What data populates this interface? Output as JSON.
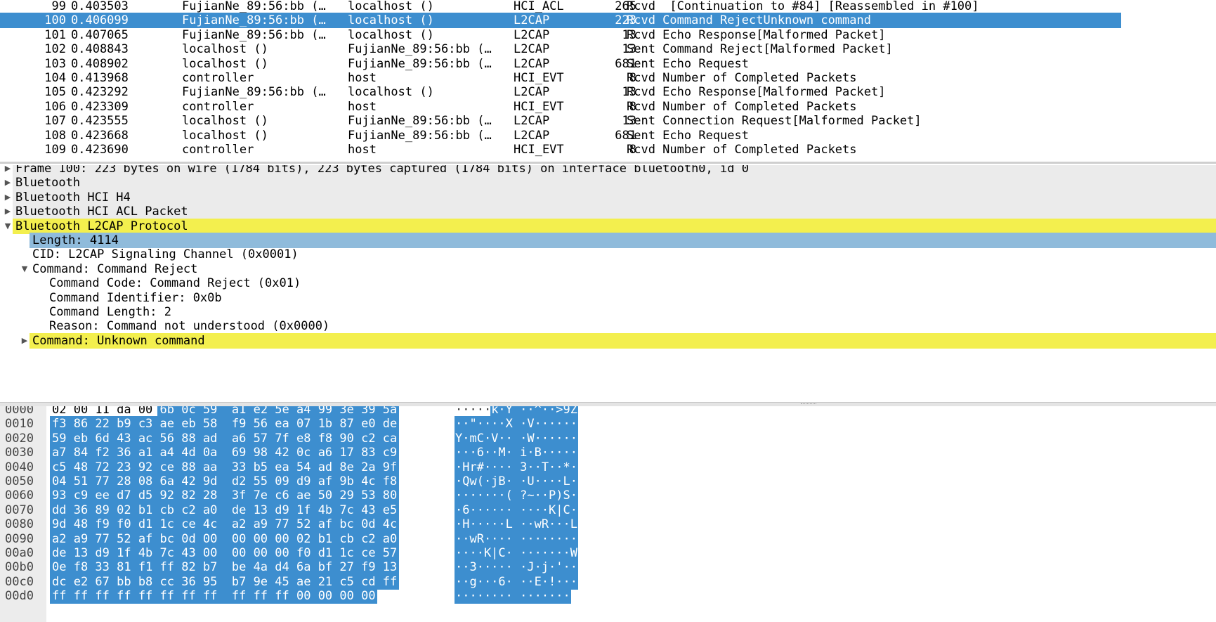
{
  "packet_list": {
    "rows": [
      {
        "no": "99",
        "time": "0.403503",
        "src": "FujianNe_89:56:bb (…",
        "dst": "localhost ()",
        "proto": "HCI_ACL",
        "len": "265",
        "info": "Rcvd  [Continuation to #84] [Reassembled in #100]",
        "selected": false
      },
      {
        "no": "100",
        "time": "0.406099",
        "src": "FujianNe_89:56:bb (…",
        "dst": "localhost ()",
        "proto": "L2CAP",
        "len": "223",
        "info": "Rcvd Command RejectUnknown command",
        "selected": true
      },
      {
        "no": "101",
        "time": "0.407065",
        "src": "FujianNe_89:56:bb (…",
        "dst": "localhost ()",
        "proto": "L2CAP",
        "len": "13",
        "info": "Rcvd Echo Response[Malformed Packet]",
        "selected": false
      },
      {
        "no": "102",
        "time": "0.408843",
        "src": "localhost ()",
        "dst": "FujianNe_89:56:bb (…",
        "proto": "L2CAP",
        "len": "13",
        "info": "Sent Command Reject[Malformed Packet]",
        "selected": false
      },
      {
        "no": "103",
        "time": "0.408902",
        "src": "localhost ()",
        "dst": "FujianNe_89:56:bb (…",
        "proto": "L2CAP",
        "len": "681",
        "info": "Sent Echo Request",
        "selected": false
      },
      {
        "no": "104",
        "time": "0.413968",
        "src": "controller",
        "dst": "host",
        "proto": "HCI_EVT",
        "len": "8",
        "info": "Rcvd Number of Completed Packets",
        "selected": false
      },
      {
        "no": "105",
        "time": "0.423292",
        "src": "FujianNe_89:56:bb (…",
        "dst": "localhost ()",
        "proto": "L2CAP",
        "len": "13",
        "info": "Rcvd Echo Response[Malformed Packet]",
        "selected": false
      },
      {
        "no": "106",
        "time": "0.423309",
        "src": "controller",
        "dst": "host",
        "proto": "HCI_EVT",
        "len": "8",
        "info": "Rcvd Number of Completed Packets",
        "selected": false
      },
      {
        "no": "107",
        "time": "0.423555",
        "src": "localhost ()",
        "dst": "FujianNe_89:56:bb (…",
        "proto": "L2CAP",
        "len": "13",
        "info": "Sent Connection Request[Malformed Packet]",
        "selected": false
      },
      {
        "no": "108",
        "time": "0.423668",
        "src": "localhost ()",
        "dst": "FujianNe_89:56:bb (…",
        "proto": "L2CAP",
        "len": "681",
        "info": "Sent Echo Request",
        "selected": false
      },
      {
        "no": "109",
        "time": "0.423690",
        "src": "controller",
        "dst": "host",
        "proto": "HCI_EVT",
        "len": "8",
        "info": "Rcvd Number of Completed Packets",
        "selected": false
      }
    ]
  },
  "details": {
    "rows": [
      {
        "text": "Frame 100: 223 bytes on wire (1784 bits), 223 bytes captured (1784 bits) on interface bluetooth0, id 0",
        "expander": "collapsed",
        "highlight": "gray"
      },
      {
        "text": "Bluetooth",
        "expander": "collapsed",
        "highlight": "gray"
      },
      {
        "text": "Bluetooth HCI H4",
        "expander": "collapsed",
        "highlight": "gray"
      },
      {
        "text": "Bluetooth HCI ACL Packet",
        "expander": "collapsed",
        "highlight": "gray"
      },
      {
        "text": "Bluetooth L2CAP Protocol",
        "expander": "expanded",
        "highlight": "yellow"
      },
      {
        "text": "Length: 4114",
        "expander": "none",
        "highlight": "blue"
      },
      {
        "text": "CID: L2CAP Signaling Channel (0x0001)",
        "expander": "none",
        "highlight": "none"
      },
      {
        "text": "Command: Command Reject",
        "expander": "expanded",
        "highlight": "none"
      },
      {
        "text": "Command Code: Command Reject (0x01)",
        "expander": "none",
        "highlight": "none"
      },
      {
        "text": "Command Identifier: 0x0b",
        "expander": "none",
        "highlight": "none"
      },
      {
        "text": "Command Length: 2",
        "expander": "none",
        "highlight": "none"
      },
      {
        "text": "Reason: Command not understood (0x0000)",
        "expander": "none",
        "highlight": "none"
      },
      {
        "text": "Command: Unknown command",
        "expander": "collapsed",
        "highlight": "yellow"
      }
    ]
  },
  "bytes": {
    "rows": [
      {
        "offset": "0000",
        "hex": "02 00 11 da 00 6b 0c 59  a1 e2 5e a4 99 3e 39 5a",
        "ascii": "·····k·Y ··^··>9Z"
      },
      {
        "offset": "0010",
        "hex": "f3 86 22 b9 c3 ae eb 58  f9 56 ea 07 1b 87 e0 de",
        "ascii": "··\"····X ·V······"
      },
      {
        "offset": "0020",
        "hex": "59 eb 6d 43 ac 56 88 ad  a6 57 7f e8 f8 90 c2 ca",
        "ascii": "Y·mC·V·· ·W······"
      },
      {
        "offset": "0030",
        "hex": "a7 84 f2 36 a1 a4 4d 0a  69 98 42 0c a6 17 83 c9",
        "ascii": "···6··M· i·B·····"
      },
      {
        "offset": "0040",
        "hex": "c5 48 72 23 92 ce 88 aa  33 b5 ea 54 ad 8e 2a 9f",
        "ascii": "·Hr#···· 3··T··*·"
      },
      {
        "offset": "0050",
        "hex": "04 51 77 28 08 6a 42 9d  d2 55 09 d9 af 9b 4c f8",
        "ascii": "·Qw(·jB· ·U····L·"
      },
      {
        "offset": "0060",
        "hex": "93 c9 ee d7 d5 92 82 28  3f 7e c6 ae 50 29 53 80",
        "ascii": "·······( ?~··P)S·"
      },
      {
        "offset": "0070",
        "hex": "dd 36 89 02 b1 cb c2 a0  de 13 d9 1f 4b 7c 43 e5",
        "ascii": "·6······ ····K|C·"
      },
      {
        "offset": "0080",
        "hex": "9d 48 f9 f0 d1 1c ce 4c  a2 a9 77 52 af bc 0d 4c",
        "ascii": "·H·····L ··wR···L"
      },
      {
        "offset": "0090",
        "hex": "a2 a9 77 52 af bc 0d 00  00 00 00 02 b1 cb c2 a0",
        "ascii": "··wR···· ········"
      },
      {
        "offset": "00a0",
        "hex": "de 13 d9 1f 4b 7c 43 00  00 00 00 f0 d1 1c ce 57",
        "ascii": "····K|C· ·······W"
      },
      {
        "offset": "00b0",
        "hex": "0e f8 33 81 f1 ff 82 b7  be 4a d4 6a bf 27 f9 13",
        "ascii": "··3····· ·J·j·'··"
      },
      {
        "offset": "00c0",
        "hex": "dc e2 67 bb b8 cc 36 95  b7 9e 45 ae 21 c5 cd ff",
        "ascii": "··g···6· ··E·!···"
      },
      {
        "offset": "00d0",
        "hex": "ff ff ff ff ff ff ff ff  ff ff ff 00 00 00 00",
        "ascii": "········ ·······"
      }
    ]
  },
  "colors": {
    "selection": "#3d8ecf",
    "field_highlight": "#8fbbdb",
    "protocol_highlight": "#f3ef4e",
    "collapsed_gray": "#ebebeb"
  }
}
